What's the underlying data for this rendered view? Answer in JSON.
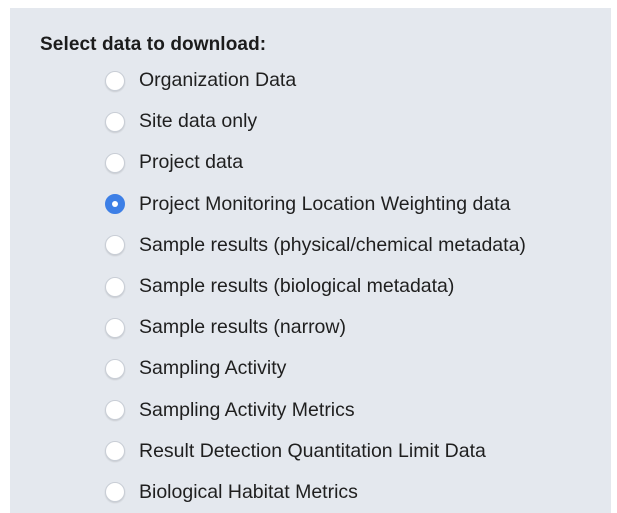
{
  "form": {
    "heading": "Select data to download:",
    "selected_index": 3,
    "options": [
      {
        "label": "Organization Data",
        "checked": false
      },
      {
        "label": "Site data only",
        "checked": false
      },
      {
        "label": "Project data",
        "checked": false
      },
      {
        "label": "Project Monitoring Location Weighting data",
        "checked": true
      },
      {
        "label": "Sample results (physical/chemical metadata)",
        "checked": false
      },
      {
        "label": "Sample results (biological metadata)",
        "checked": false
      },
      {
        "label": "Sample results (narrow)",
        "checked": false
      },
      {
        "label": "Sampling Activity",
        "checked": false
      },
      {
        "label": "Sampling Activity Metrics",
        "checked": false
      },
      {
        "label": "Result Detection Quantitation Limit Data",
        "checked": false
      },
      {
        "label": "Biological Habitat Metrics",
        "checked": false
      }
    ]
  },
  "colors": {
    "panel_background": "#e4e8ee",
    "radio_selected": "#3d7fe6",
    "text": "#1f1f1f"
  }
}
